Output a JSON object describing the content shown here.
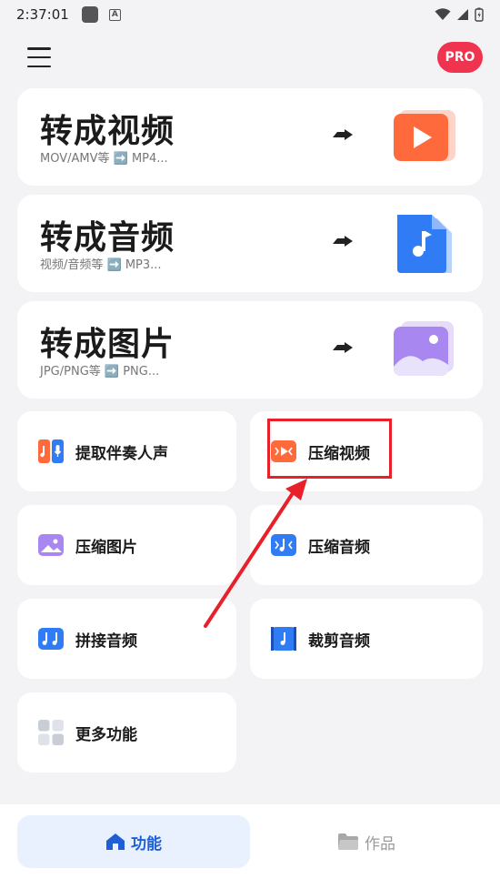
{
  "status_bar": {
    "time": "2:37:01"
  },
  "header": {
    "pro_label": "PRO"
  },
  "big_cards": [
    {
      "title": "转成视频",
      "subtitle": "MOV/AMV等 ➡️ MP4..."
    },
    {
      "title": "转成音频",
      "subtitle": "视频/音频等 ➡️ MP3..."
    },
    {
      "title": "转成图片",
      "subtitle": "JPG/PNG等 ➡️ PNG..."
    }
  ],
  "tools": [
    {
      "label": "提取伴奏人声"
    },
    {
      "label": "压缩视频"
    },
    {
      "label": "压缩图片"
    },
    {
      "label": "压缩音频"
    },
    {
      "label": "拼接音频"
    },
    {
      "label": "裁剪音频"
    },
    {
      "label": "更多功能"
    }
  ],
  "bottom_nav": [
    {
      "label": "功能",
      "active": true
    },
    {
      "label": "作品",
      "active": false
    }
  ],
  "colors": {
    "accent": "#1f5fd6",
    "pro": "#f0334e",
    "highlight": "#e8202a"
  }
}
